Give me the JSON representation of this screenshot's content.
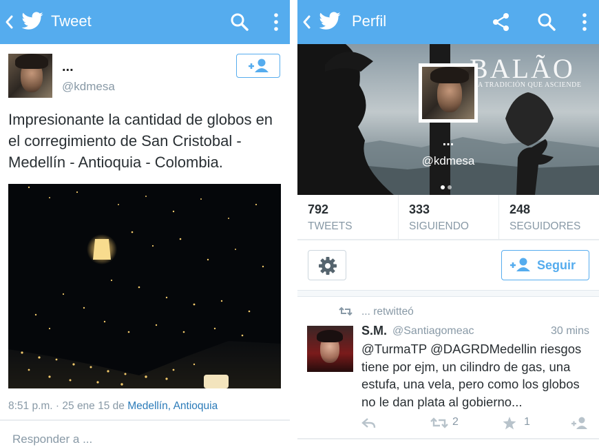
{
  "left": {
    "appbar": {
      "title": "Tweet"
    },
    "tweet": {
      "name": "...",
      "handle": "@kdmesa",
      "text": "Impresionante la cantidad de globos en el corregimiento de San Cristobal - Medellín - Antioquia - Colombia.",
      "time": "8:51 p.m. · 25 ene 15",
      "de": " de ",
      "location": "Medellín, Antioquia"
    },
    "reply_placeholder": "Responder a ..."
  },
  "right": {
    "appbar": {
      "title": "Perfil"
    },
    "banner": {
      "brand": "BALÃO",
      "brand_sub": "A TRADICIÓN QUE ASCIENDE"
    },
    "profile": {
      "name": "...",
      "handle": "@kdmesa"
    },
    "stats": [
      {
        "num": "792",
        "label": "TWEETS"
      },
      {
        "num": "333",
        "label": "SIGUIENDO"
      },
      {
        "num": "248",
        "label": "SEGUIDORES"
      }
    ],
    "follow_label": "Seguir",
    "timeline": {
      "retweet_line": "... retwitteó",
      "name": "S.M.",
      "handle": "@Santiagomeac",
      "time": "30 mins",
      "text": "@TurmaTP @DAGRDMedellin riesgos tiene por ejm, un cilindro de gas, una estufa, una vela, pero como los globos no le dan plata al gobierno...",
      "retweets": "2",
      "favorites": "1"
    }
  },
  "colors": {
    "brand_blue": "#55acee",
    "muted": "#8899a6",
    "link": "#2b7bb9"
  },
  "icons": [
    "back-icon",
    "twitter-bird-icon",
    "search-icon",
    "overflow-menu-icon",
    "share-icon",
    "add-user-icon",
    "gear-icon",
    "retweet-icon",
    "reply-icon",
    "favorite-icon"
  ]
}
